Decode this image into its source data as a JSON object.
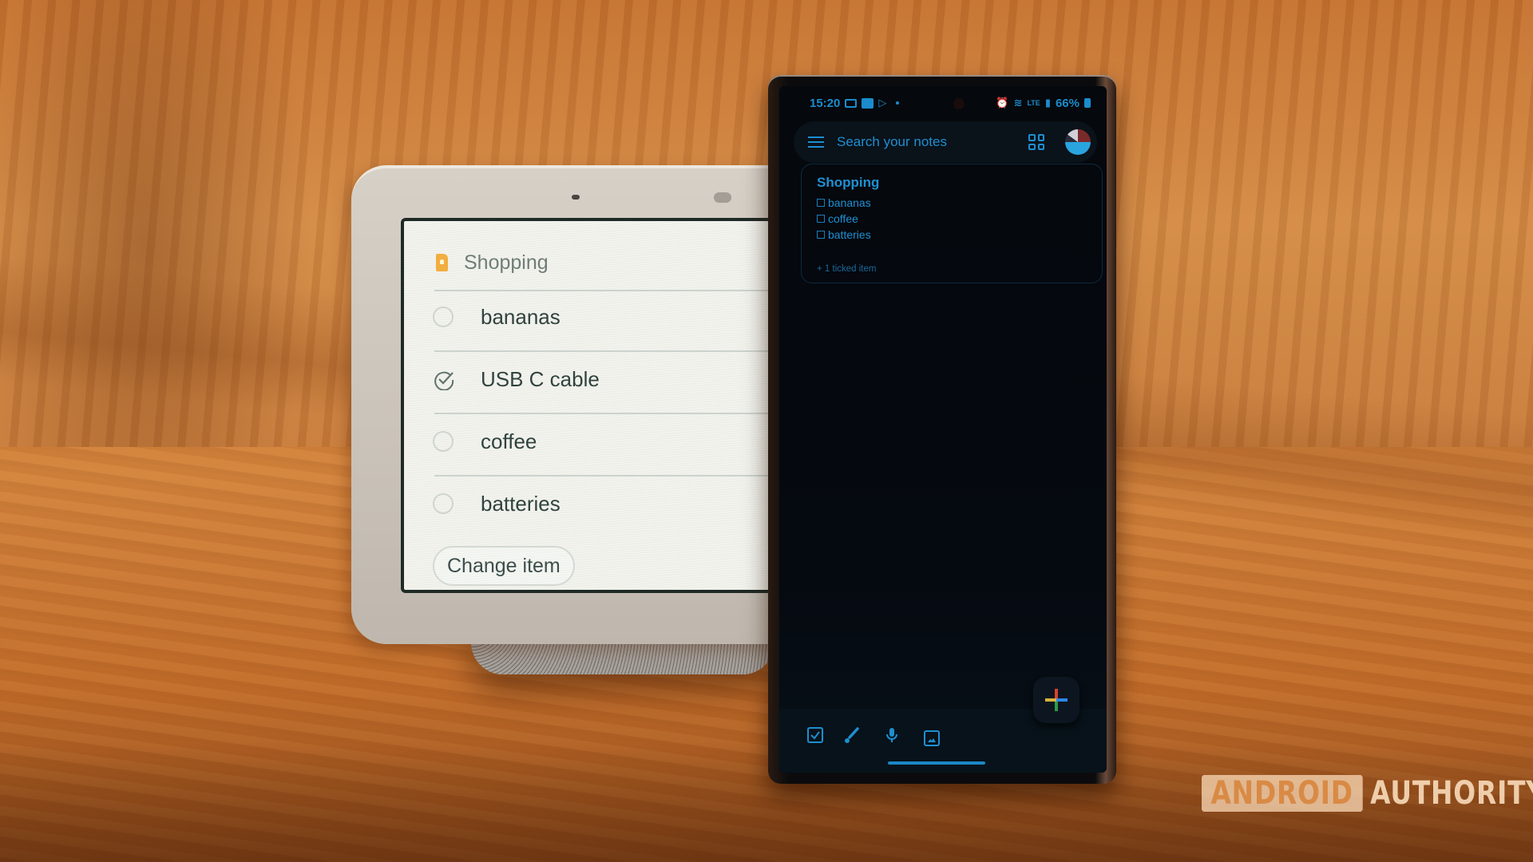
{
  "nest_hub": {
    "note_title": "Shopping",
    "items": [
      {
        "label": "bananas",
        "checked": false
      },
      {
        "label": "USB C cable",
        "checked": true
      },
      {
        "label": "coffee",
        "checked": false
      },
      {
        "label": "batteries",
        "checked": false
      }
    ],
    "change_item_button": "Change item"
  },
  "phone": {
    "status_bar": {
      "time": "15:20",
      "left_icons": [
        "screen-cast-icon",
        "app-notification-icon",
        "play-store-icon",
        "notification-dot-icon"
      ],
      "right_icons": [
        "alarm-icon",
        "wifi-icon",
        "volte-lte-icon",
        "signal-icon"
      ],
      "battery": "66%"
    },
    "search": {
      "placeholder": "Search your notes"
    },
    "note": {
      "title": "Shopping",
      "items": [
        "bananas",
        "coffee",
        "batteries"
      ],
      "ticked_summary": "+ 1 ticked item"
    },
    "bottom_bar_icons": [
      "new-list-icon",
      "drawing-icon",
      "voice-note-icon",
      "image-note-icon"
    ],
    "fab_icon": "google-plus-icon",
    "colors": {
      "accent": "#1d8fd0",
      "background": "#05080c"
    }
  },
  "watermark": {
    "boxed": "ANDROID",
    "plain": "AUTHORITY"
  }
}
